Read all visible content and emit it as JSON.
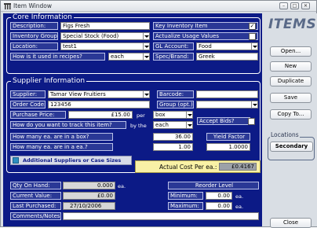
{
  "window": {
    "title": "Item Window"
  },
  "core": {
    "heading": "Core Information",
    "description_label": "Description:",
    "description_value": "Figs Fresh",
    "key_inventory_label": "Key Inventory Item",
    "key_inventory_checked": "✓",
    "inventory_group_label": "Inventory Group:",
    "inventory_group_value": "Special Stock  (Food)",
    "actualize_label": "Actualize Usage Values",
    "location_label": "Location:",
    "location_value": "test1",
    "gl_account_label": "GL Account:",
    "gl_account_value": "Food",
    "recipes_label": "How is it used in recipes?",
    "recipes_value": "each",
    "spec_brand_label": "Spec/Brand:",
    "spec_brand_value": "Greek"
  },
  "supplier": {
    "heading": "Supplier Information",
    "supplier_label": "Supplier:",
    "supplier_value": "Tamar View Fruitiers",
    "barcode_label": "Barcode:",
    "barcode_value": "",
    "order_code_label": "Order Code:",
    "order_code_value": "123456",
    "group_label": "Group (opt.)",
    "group_value": "",
    "purchase_price_label": "Purchase Price:",
    "purchase_price_value": "£15.00",
    "per_label": "per",
    "per_unit_value": "box",
    "track_label": "How do you want to track this item?",
    "by_the_label": "by the",
    "track_value": "each",
    "accept_bids_label": "Accept Bids?",
    "ea_in_box_label": "How many ea. are in a box?",
    "ea_in_box_value": "36.00",
    "yield_factor_label": "Yield Factor",
    "ea_in_ea_label": "How many ea. are in a ea.?",
    "ea_in_ea_value": "1.00",
    "yield_factor_value": "1.0000",
    "additional_button": "Additional Suppliers or Case Sizes",
    "actual_cost_label": "Actual Cost Per ea.:",
    "actual_cost_value": "£0.4167"
  },
  "stock": {
    "qty_on_hand_label": "Qty On Hand:",
    "qty_on_hand_value": "0.000",
    "qty_unit": "ea.",
    "current_value_label": "Current Value:",
    "current_value_value": "£0.00",
    "last_purchased_label": "Last Purchased:",
    "last_purchased_value": "27/10/2006",
    "comments_label": "Comments/Notes:",
    "comments_value": "",
    "reorder_label": "Reorder Level",
    "minimum_label": "Minimum:",
    "minimum_value": "0.00",
    "maximum_label": "Maximum:",
    "maximum_value": "0.00",
    "reorder_unit": "ea."
  },
  "sidebar": {
    "logo": "ITEMS",
    "open": "Open...",
    "new": "New",
    "duplicate": "Duplicate",
    "save": "Save",
    "copy_to": "Copy To...",
    "locations_title": "Locations",
    "secondary": "Secondary",
    "close": "Close"
  }
}
